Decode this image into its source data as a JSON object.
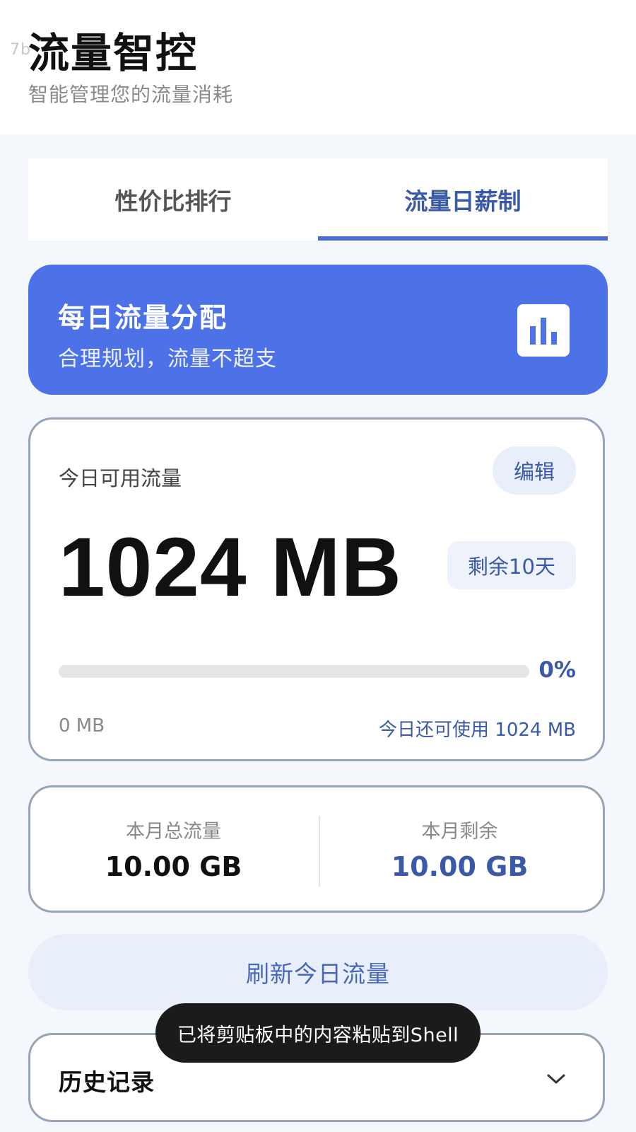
{
  "header": {
    "watermark": "7b",
    "title": "流量智控",
    "subtitle": "智能管理您的流量消耗"
  },
  "tabs": [
    {
      "label": "性价比排行",
      "active": false
    },
    {
      "label": "流量日薪制",
      "active": true
    }
  ],
  "banner": {
    "title": "每日流量分配",
    "subtitle": "合理规划，流量不超支",
    "icon": "bar-chart-icon"
  },
  "daily": {
    "label": "今日可用流量",
    "edit_label": "编辑",
    "value": "1024 MB",
    "days_left": "剩余10天",
    "progress_percent": 0,
    "progress_label": "0%",
    "used": "0 MB",
    "remaining": "今日还可使用 1024 MB"
  },
  "monthly": {
    "total_label": "本月总流量",
    "total_value": "10.00 GB",
    "remaining_label": "本月剩余",
    "remaining_value": "10.00 GB"
  },
  "refresh_label": "刷新今日流量",
  "history": {
    "label": "历史记录",
    "icon": "chevron-down-icon"
  },
  "toast": "已将剪贴板中的内容粘贴到Shell",
  "colors": {
    "accent": "#4d72e8",
    "accent_text": "#3a5aa8",
    "card_border": "#98a4b8",
    "background": "#f4f7fb"
  }
}
